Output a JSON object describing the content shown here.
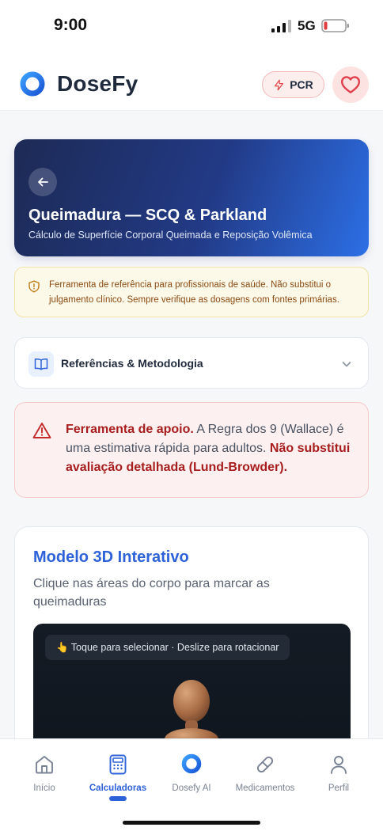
{
  "status_bar": {
    "time": "9:00",
    "network": "5G"
  },
  "header": {
    "app_name": "DoseFy",
    "pcr_label": "PCR",
    "logo_icon": "dosefy-ring-logo",
    "favorite_icon": "heart-icon"
  },
  "hero": {
    "title": "Queimadura — SCQ & Parkland",
    "subtitle": "Cálculo de Superfície Corporal Queimada e Reposição Volêmica"
  },
  "disclaimer": {
    "text": "Ferramenta de referência para profissionais de saúde. Não substitui o julgamento clínico. Sempre verifique as dosagens com fontes primárias."
  },
  "references": {
    "title": "Referências & Metodologia"
  },
  "warning": {
    "strong_intro": "Ferramenta de apoio.",
    "body": " A Regra dos 9 (Wallace) é uma estimativa rápida para adultos. ",
    "strong_outro": "Não substitui avaliação detalhada (Lund-Browder)."
  },
  "model": {
    "title": "Modelo 3D Interativo",
    "description": "Clique nas áreas do corpo para marcar as queimaduras",
    "hint": "👆 Toque para selecionar · Deslize para rotacionar"
  },
  "nav": {
    "items": [
      {
        "label": "Início",
        "icon": "home-icon"
      },
      {
        "label": "Calculadoras",
        "icon": "calculator-icon"
      },
      {
        "label": "Dosefy AI",
        "icon": "ai-ring-icon"
      },
      {
        "label": "Medicamentos",
        "icon": "pill-icon"
      },
      {
        "label": "Perfil",
        "icon": "user-icon"
      }
    ],
    "active": "Calculadoras"
  },
  "colors": {
    "accent": "#2d62d8",
    "danger": "#a81d1d",
    "hero_start": "#1d2a55",
    "hero_end": "#2c6fe6"
  }
}
